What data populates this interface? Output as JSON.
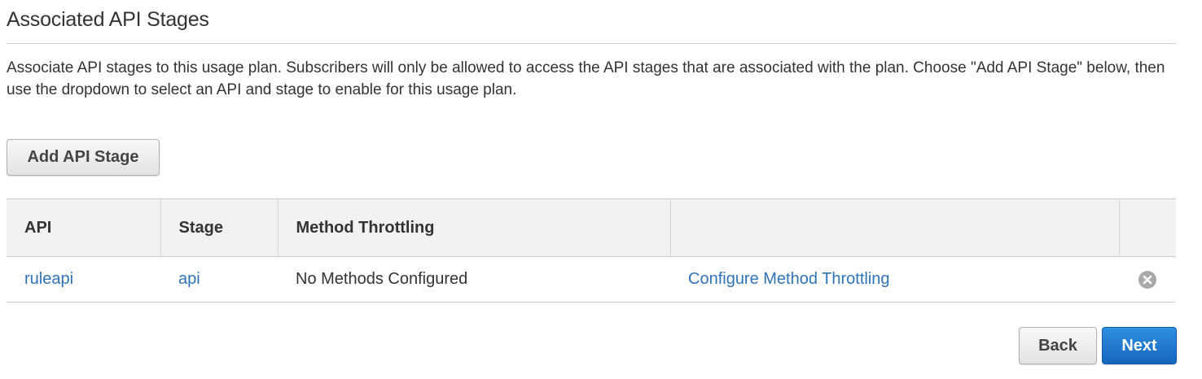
{
  "section": {
    "title": "Associated API Stages",
    "description": "Associate API stages to this usage plan. Subscribers will only be allowed to access the API stages that are associated with the plan. Choose \"Add API Stage\" below, then use the dropdown to select an API and stage to enable for this usage plan."
  },
  "actions": {
    "add_stage_label": "Add API Stage"
  },
  "table": {
    "columns": [
      "API",
      "Stage",
      "Method Throttling",
      "",
      ""
    ],
    "rows": [
      {
        "api": "ruleapi",
        "stage": "api",
        "method_throttling": "No Methods Configured",
        "configure_link": "Configure Method Throttling",
        "remove_icon": "close-circle-icon"
      }
    ]
  },
  "footer": {
    "back_label": "Back",
    "next_label": "Next"
  },
  "colors": {
    "link": "#2f73b7",
    "primary_button": "#1a6fc7",
    "header_background": "#f2f2f2",
    "remove_icon": "#a9a9a9"
  }
}
